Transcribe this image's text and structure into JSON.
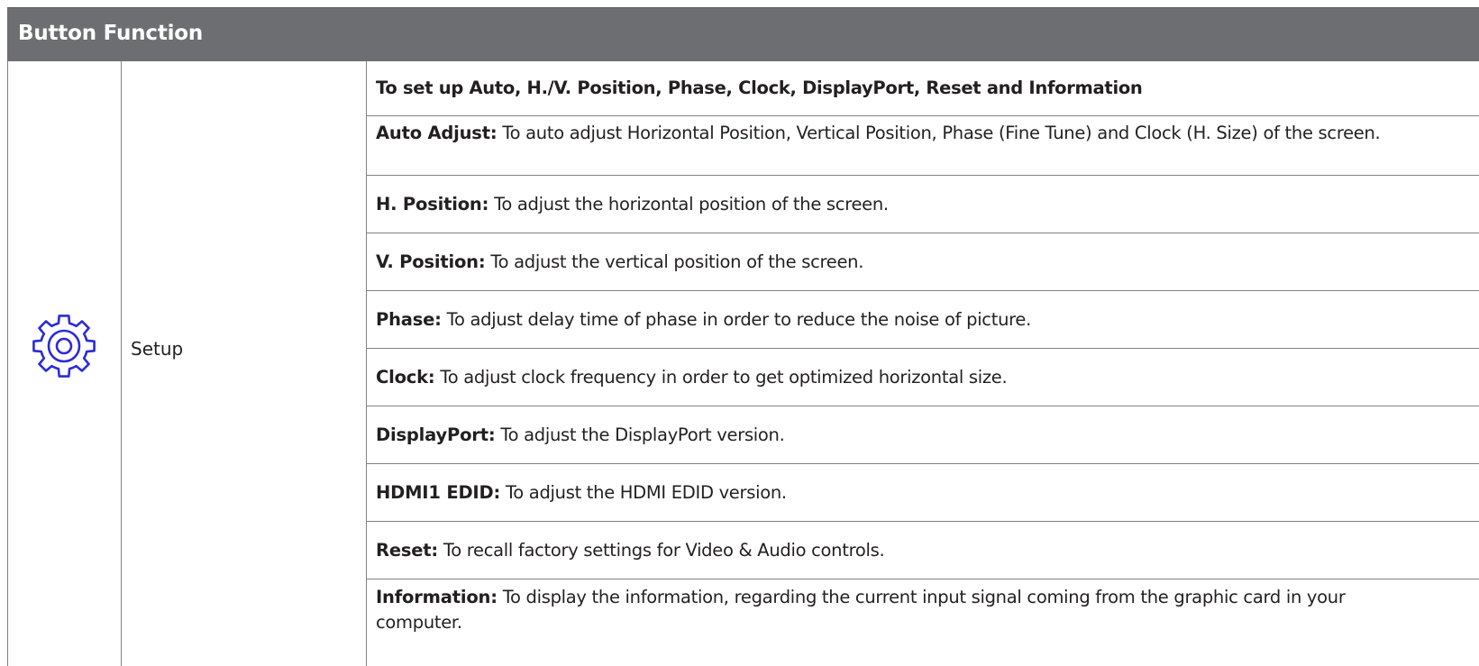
{
  "table": {
    "title": "Button Function",
    "icon": "gear-icon",
    "label": "Setup",
    "heading": "To set up Auto, H./V. Position, Phase, Clock, DisplayPort, Reset and Information",
    "items": [
      {
        "term": "Auto Adjust:",
        "desc": " To auto adjust Horizontal Position, Vertical Position, Phase (Fine Tune) and Clock (H. Size) of the screen."
      },
      {
        "term": "H. Position:",
        "desc": " To adjust the horizontal position of the screen."
      },
      {
        "term": "V. Position:",
        "desc": " To adjust the vertical position of the screen."
      },
      {
        "term": "Phase:",
        "desc": " To adjust delay time of phase in order to reduce the noise of picture."
      },
      {
        "term": "Clock:",
        "desc": " To adjust clock frequency in order to get optimized horizontal size."
      },
      {
        "term": "DisplayPort:",
        "desc": " To adjust the DisplayPort version."
      },
      {
        "term": "HDMI1 EDID:",
        "desc": " To adjust the HDMI EDID version."
      },
      {
        "term": "Reset:",
        "desc": " To recall factory settings for Video & Audio controls."
      },
      {
        "term": "Information:",
        "desc": " To display the information, regarding the current input signal coming from the graphic card in your computer."
      }
    ]
  },
  "colors": {
    "header_bg": "#6d6e71",
    "header_text": "#ffffff",
    "icon_blue": "#2b2bd9",
    "border": "#808285",
    "text": "#231f20"
  }
}
